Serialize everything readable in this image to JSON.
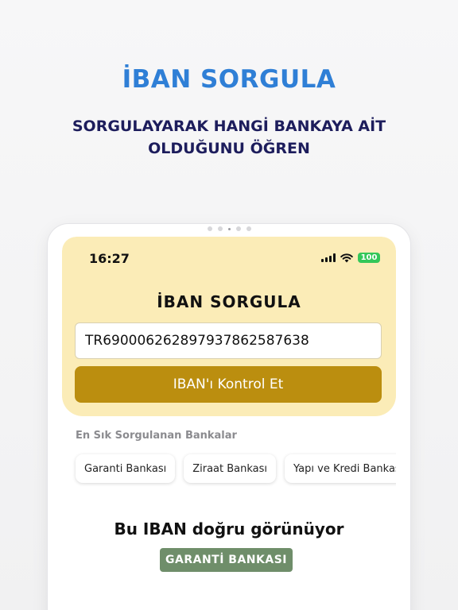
{
  "promo": {
    "title": "İBAN SORGULA",
    "subtitle": "SORGULAYARAK HANGİ BANKAYA AİT OLDUĞUNU ÖĞREN"
  },
  "status_bar": {
    "time": "16:27",
    "battery": "100"
  },
  "screen": {
    "title": "İBAN SORGULA",
    "iban_value": "TR690006262897937862587638",
    "check_button_label": "IBAN'ı Kontrol Et",
    "section_label": "En Sık Sorgulanan Bankalar",
    "banks": [
      {
        "label": "Garanti Bankası"
      },
      {
        "label": "Ziraat Bankası"
      },
      {
        "label": "Yapı ve Kredi Bankası"
      }
    ],
    "result_title": "Bu IBAN doğru görünüyor",
    "result_bank": "GARANTİ BANKASI"
  },
  "colors": {
    "header_bg": "#fbecb7",
    "button": "#bb8e0f",
    "badge": "#6f8e6a",
    "promo_title": "#2f7fd6",
    "promo_subtitle": "#1d1d5c"
  }
}
